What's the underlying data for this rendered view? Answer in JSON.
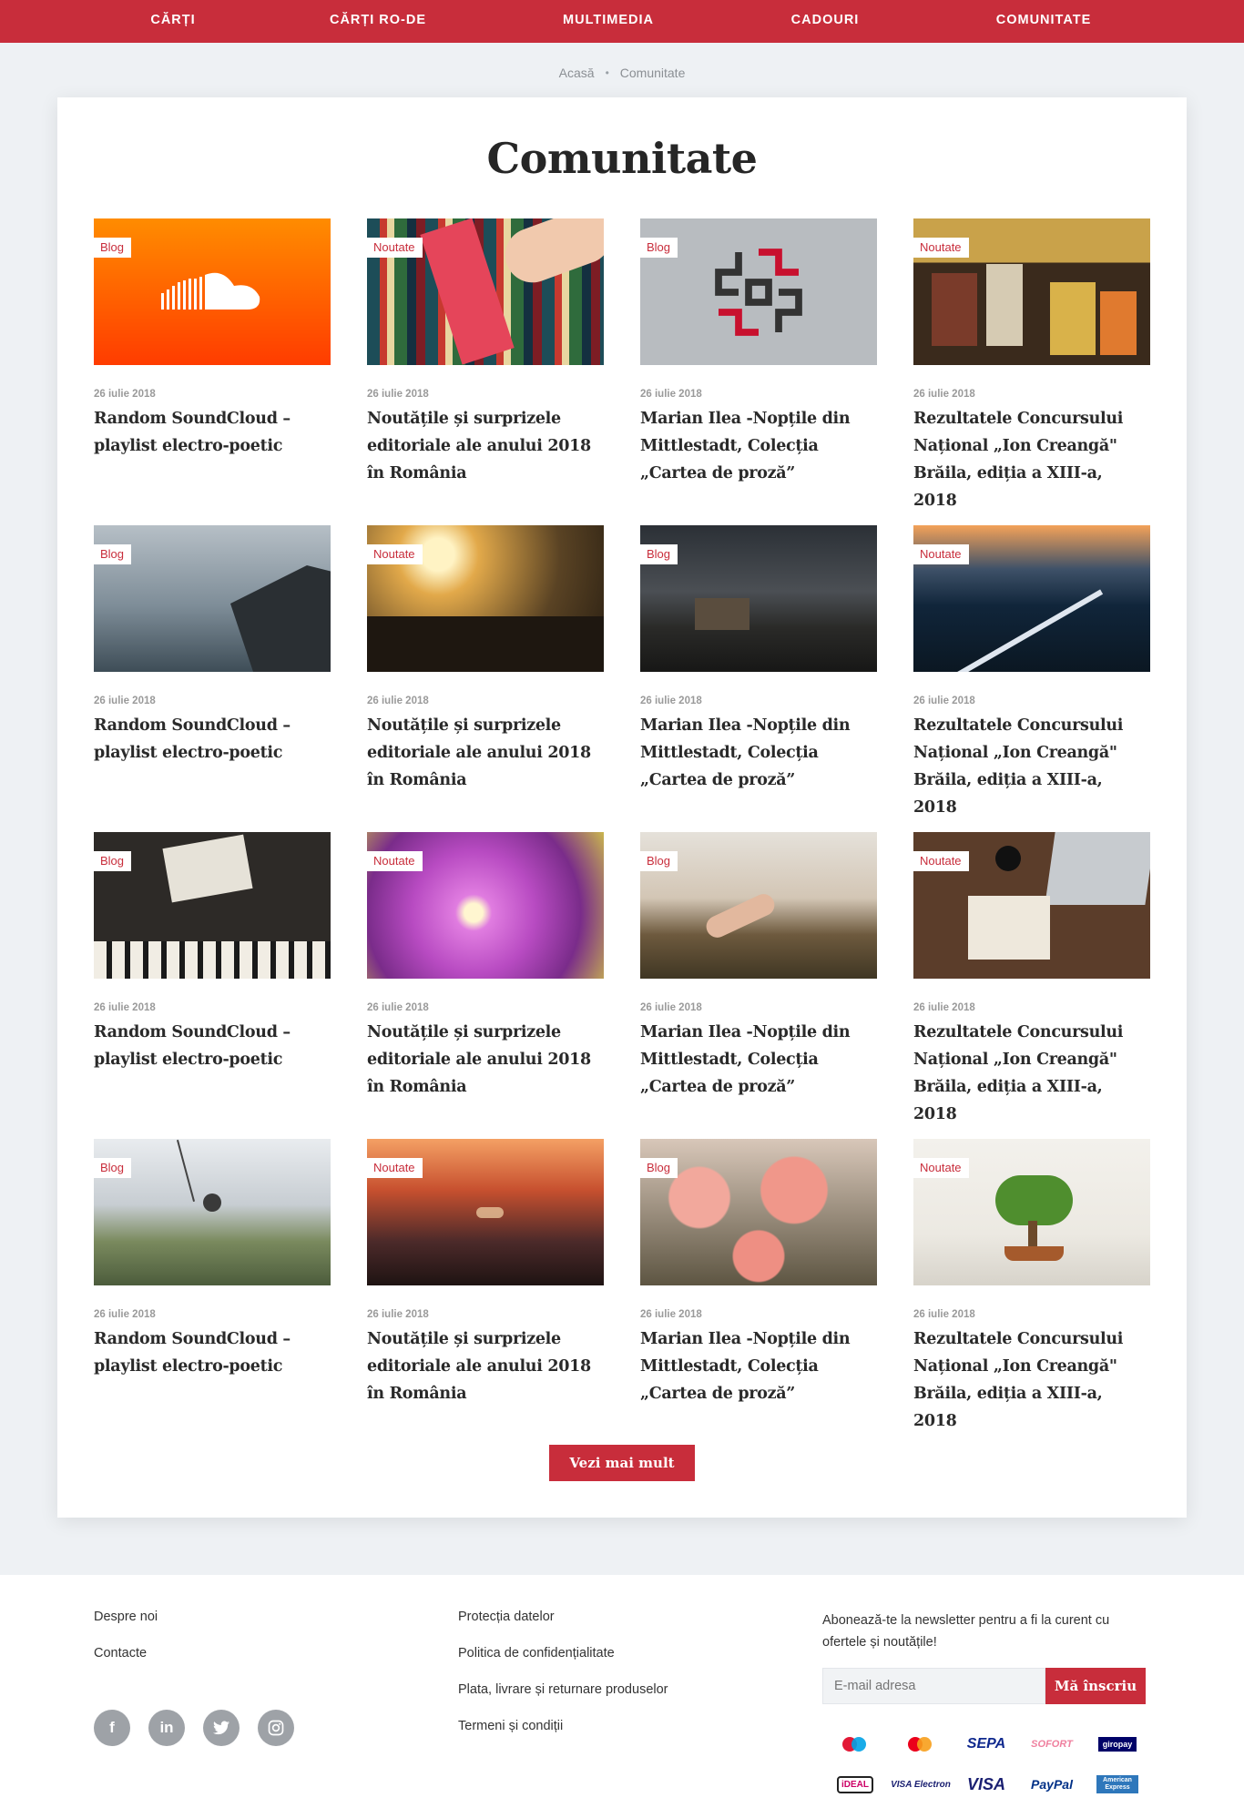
{
  "nav": {
    "items": [
      "CĂRȚI",
      "CĂRȚI RO-DE",
      "MULTIMEDIA",
      "CADOURI",
      "COMUNITATE"
    ]
  },
  "breadcrumb": {
    "home": "Acasă",
    "separator": "•",
    "current": "Comunitate"
  },
  "page": {
    "title": "Comunitate",
    "more_button": "Vezi mai mult"
  },
  "posts": [
    {
      "tag": "Blog",
      "date": "26 iulie 2018",
      "title": "Random SoundCloud – playlist electro-poetic",
      "image": "soundcloud-logo"
    },
    {
      "tag": "Noutate",
      "date": "26 iulie 2018",
      "title": "Noutățile și surprizele editoriale ale anului 2018 în România",
      "image": "bookshelf"
    },
    {
      "tag": "Blog",
      "date": "26 iulie 2018",
      "title": "Marian Ilea -Nopțile din Mittlestadt, Colecția „Cartea de proză”",
      "image": "red-black-symbol"
    },
    {
      "tag": "Noutate",
      "date": "26 iulie 2018",
      "title": "Rezultatele Concursului Național „Ion Creangă\" Brăila, ediția a XIII-a, 2018",
      "image": "book-display"
    },
    {
      "tag": "Blog",
      "date": "26 iulie 2018",
      "title": "Random SoundCloud – playlist electro-poetic",
      "image": "cliff-fjord"
    },
    {
      "tag": "Noutate",
      "date": "26 iulie 2018",
      "title": "Noutățile și surprizele editoriale ale anului 2018 în România",
      "image": "sunset-people"
    },
    {
      "tag": "Blog",
      "date": "26 iulie 2018",
      "title": "Marian Ilea -Nopțile din Mittlestadt, Colecția „Cartea de proză”",
      "image": "dark-hut"
    },
    {
      "tag": "Noutate",
      "date": "26 iulie 2018",
      "title": "Rezultatele Concursului Național „Ion Creangă\" Brăila, ediția a XIII-a, 2018",
      "image": "city-bridge"
    },
    {
      "tag": "Blog",
      "date": "26 iulie 2018",
      "title": "Random SoundCloud – playlist electro-poetic",
      "image": "piano-playme"
    },
    {
      "tag": "Noutate",
      "date": "26 iulie 2018",
      "title": "Noutățile și surprizele editoriale ale anului 2018 în România",
      "image": "purple-flower"
    },
    {
      "tag": "Blog",
      "date": "26 iulie 2018",
      "title": "Marian Ilea -Nopțile din Mittlestadt, Colecția „Cartea de proză”",
      "image": "hand-landscape"
    },
    {
      "tag": "Noutate",
      "date": "26 iulie 2018",
      "title": "Rezultatele Concursului Național „Ion Creangă\" Brăila, ediția a XIII-a, 2018",
      "image": "desk-laptop"
    },
    {
      "tag": "Blog",
      "date": "26 iulie 2018",
      "title": "Random SoundCloud – playlist electro-poetic",
      "image": "swing-mountain"
    },
    {
      "tag": "Noutate",
      "date": "26 iulie 2018",
      "title": "Noutățile și surprizele editoriale ale anului 2018 în România",
      "image": "bottle-sunset"
    },
    {
      "tag": "Blog",
      "date": "26 iulie 2018",
      "title": "Marian Ilea -Nopțile din Mittlestadt, Colecția „Cartea de proză”",
      "image": "pink-dahlias"
    },
    {
      "tag": "Noutate",
      "date": "26 iulie 2018",
      "title": "Rezultatele Concursului Național „Ion Creangă\" Brăila, ediția a XIII-a, 2018",
      "image": "bonsai"
    }
  ],
  "footer": {
    "col1": [
      "Despre noi",
      "Contacte"
    ],
    "col2": [
      "Protecția datelor",
      "Politica de confidențialitate",
      "Plata, livrare și returnare produselor",
      "Termeni și condiții"
    ],
    "newsletter_text": "Abonează-te la newsletter pentru a fi la curent cu ofertele și noutățile!",
    "email_placeholder": "E-mail adresa",
    "subscribe_label": "Mă înscriu",
    "social": [
      "facebook-icon",
      "linkedin-icon",
      "twitter-icon",
      "instagram-icon"
    ],
    "payments": [
      "Maestro",
      "Mastercard",
      "SEPA",
      "SOFORT",
      "giropay",
      "iDEAL",
      "VISA Electron",
      "VISA",
      "PayPal",
      "American Express"
    ]
  },
  "colors": {
    "accent": "#c82d3b",
    "background": "#eef1f4"
  }
}
